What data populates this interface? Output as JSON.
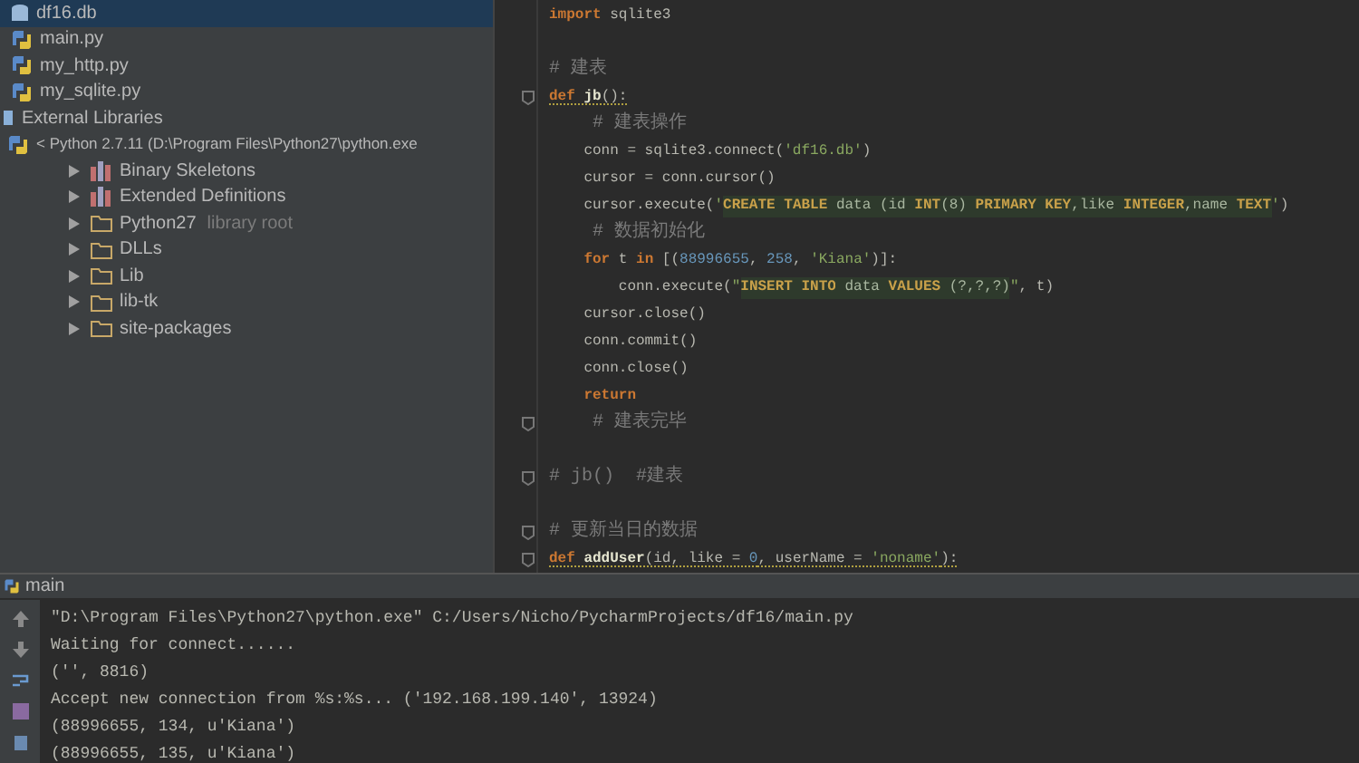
{
  "project_tree": [
    {
      "label": "df16.db",
      "kind": "db",
      "selected": true
    },
    {
      "label": "main.py",
      "kind": "python",
      "selected": false
    },
    {
      "label": "my_http.py",
      "kind": "python",
      "selected": false
    },
    {
      "label": "my_sqlite.py",
      "kind": "python",
      "selected": false
    },
    {
      "label": "External Libraries",
      "kind": "library",
      "selected": false,
      "children": [
        {
          "label": "< Python 2.7.11 (D:\\Program Files\\Python27\\python.exe",
          "kind": "interpreter",
          "selected": false,
          "children": [
            {
              "label": "Binary Skeletons",
              "kind": "bars",
              "selected": false,
              "expanded": false
            },
            {
              "label": "Extended Definitions",
              "kind": "bars",
              "selected": false,
              "expanded": false
            },
            {
              "label": "Python27",
              "note": "library root",
              "kind": "folder",
              "selected": false,
              "expanded": false
            },
            {
              "label": "DLLs",
              "kind": "folder",
              "selected": false,
              "expanded": false
            },
            {
              "label": "Lib",
              "kind": "folder",
              "selected": false,
              "expanded": false
            },
            {
              "label": "lib-tk",
              "kind": "folder",
              "selected": false,
              "expanded": false
            },
            {
              "label": "site-packages",
              "kind": "folder",
              "selected": false,
              "expanded": false
            }
          ]
        }
      ]
    }
  ],
  "editor": {
    "lines": [
      {
        "kind": "code",
        "tokens": [
          {
            "kind": "kw",
            "text": "import"
          },
          {
            "kind": "text",
            "text": " sqlite3"
          }
        ]
      },
      {
        "kind": "blank"
      },
      {
        "kind": "code",
        "tokens": [
          {
            "kind": "com",
            "text": "# 建表"
          }
        ]
      },
      {
        "kind": "code",
        "fold": true,
        "warning": true,
        "tokens": [
          {
            "kind": "kw",
            "text": "def"
          },
          {
            "kind": "fn",
            "text": " jb"
          },
          {
            "kind": "text",
            "text": "():"
          }
        ]
      },
      {
        "kind": "code",
        "tokens": [
          {
            "kind": "com",
            "text": "    # 建表操作"
          }
        ]
      },
      {
        "kind": "code",
        "tokens": [
          {
            "kind": "text",
            "text": "    conn = sqlite3.connect("
          },
          {
            "kind": "str",
            "text": "'df16.db'"
          },
          {
            "kind": "text",
            "text": ")"
          }
        ]
      },
      {
        "kind": "code",
        "tokens": [
          {
            "kind": "text",
            "text": "    cursor = conn.cursor()"
          }
        ]
      },
      {
        "kind": "code",
        "tokens": [
          {
            "kind": "text",
            "text": "    cursor.execute("
          },
          {
            "kind": "str",
            "text": "'"
          },
          {
            "kind": "sql",
            "text": "CREATE TABLE"
          },
          {
            "kind": "sqltext",
            "text": " data (id "
          },
          {
            "kind": "sql",
            "text": "INT"
          },
          {
            "kind": "sqltext",
            "text": "(8) "
          },
          {
            "kind": "sql",
            "text": "PRIMARY KEY"
          },
          {
            "kind": "sqltext",
            "text": ",like "
          },
          {
            "kind": "sql",
            "text": "INTEGER"
          },
          {
            "kind": "sqltext",
            "text": ",name "
          },
          {
            "kind": "sql",
            "text": "TEXT"
          },
          {
            "kind": "str",
            "text": "'"
          },
          {
            "kind": "text",
            "text": ")"
          }
        ]
      },
      {
        "kind": "code",
        "tokens": [
          {
            "kind": "com",
            "text": "    # 数据初始化"
          }
        ]
      },
      {
        "kind": "code",
        "tokens": [
          {
            "kind": "kw",
            "text": "    for"
          },
          {
            "kind": "text",
            "text": " t "
          },
          {
            "kind": "kw",
            "text": "in"
          },
          {
            "kind": "text",
            "text": " [("
          },
          {
            "kind": "num",
            "text": "88996655"
          },
          {
            "kind": "text",
            "text": ", "
          },
          {
            "kind": "num",
            "text": "258"
          },
          {
            "kind": "text",
            "text": ", "
          },
          {
            "kind": "str",
            "text": "'Kiana'"
          },
          {
            "kind": "text",
            "text": ")]:"
          }
        ]
      },
      {
        "kind": "code",
        "tokens": [
          {
            "kind": "text",
            "text": "        conn.execute("
          },
          {
            "kind": "str",
            "text": "\""
          },
          {
            "kind": "sql",
            "text": "INSERT INTO"
          },
          {
            "kind": "sqltext",
            "text": " data "
          },
          {
            "kind": "sql",
            "text": "VALUES"
          },
          {
            "kind": "sqltext",
            "text": " (?,?,?)"
          },
          {
            "kind": "str",
            "text": "\""
          },
          {
            "kind": "text",
            "text": ", t)"
          }
        ]
      },
      {
        "kind": "code",
        "tokens": [
          {
            "kind": "text",
            "text": "    cursor.close()"
          }
        ]
      },
      {
        "kind": "code",
        "tokens": [
          {
            "kind": "text",
            "text": "    conn.commit()"
          }
        ]
      },
      {
        "kind": "code",
        "tokens": [
          {
            "kind": "text",
            "text": "    conn.close()"
          }
        ]
      },
      {
        "kind": "code",
        "tokens": [
          {
            "kind": "kw",
            "text": "    return"
          }
        ]
      },
      {
        "kind": "code",
        "fold": true,
        "tokens": [
          {
            "kind": "com",
            "text": "    # 建表完毕"
          }
        ]
      },
      {
        "kind": "blank"
      },
      {
        "kind": "code",
        "fold": true,
        "tokens": [
          {
            "kind": "com",
            "text": "# jb()  #建表"
          }
        ]
      },
      {
        "kind": "blank"
      },
      {
        "kind": "code",
        "fold": true,
        "tokens": [
          {
            "kind": "com",
            "text": "# 更新当日的数据"
          }
        ]
      },
      {
        "kind": "code",
        "fold": true,
        "warning": true,
        "tokens": [
          {
            "kind": "kw",
            "text": "def"
          },
          {
            "kind": "fn",
            "text": " addUser"
          },
          {
            "kind": "text",
            "text": "(id, like = "
          },
          {
            "kind": "num",
            "text": "0"
          },
          {
            "kind": "text",
            "text": ", userName = "
          },
          {
            "kind": "str",
            "text": "'noname'"
          },
          {
            "kind": "text",
            "text": "):"
          }
        ]
      }
    ]
  },
  "run_panel": {
    "tab": "main",
    "output": [
      "\"D:\\Program Files\\Python27\\python.exe\" C:/Users/Nicho/PycharmProjects/df16/main.py",
      "Waiting for connect......",
      "('', 8816)",
      "Accept new connection from %s:%s... ('192.168.199.140', 13924)",
      "(88996655, 134, u'Kiana')",
      "(88996655, 135, u'Kiana')"
    ]
  }
}
